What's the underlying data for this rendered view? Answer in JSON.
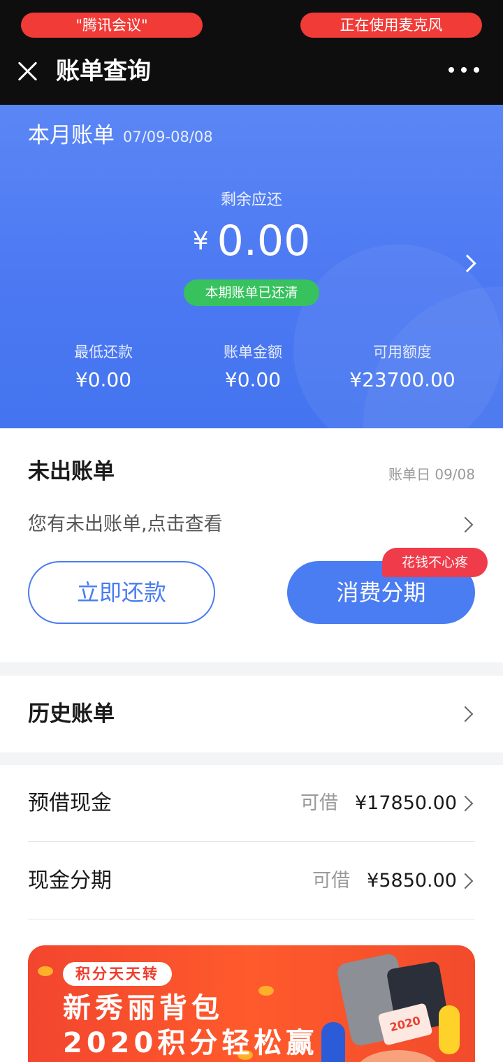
{
  "status": {
    "left_pill": "\"腾讯会议\"",
    "right_pill": "正在使用麦克风"
  },
  "nav": {
    "title": "账单查询"
  },
  "bill": {
    "title": "本月账单",
    "period": "07/09-08/08",
    "remain_label": "剩余应还",
    "currency": "¥",
    "remain_amount": "0.00",
    "status_badge": "本期账单已还清",
    "stats": [
      {
        "label": "最低还款",
        "value": "¥0.00"
      },
      {
        "label": "账单金额",
        "value": "¥0.00"
      },
      {
        "label": "可用额度",
        "value": "¥23700.00"
      }
    ]
  },
  "unbilled": {
    "title": "未出账单",
    "bill_day": "账单日 09/08",
    "hint": "您有未出账单,点击查看",
    "repay_button": "立即还款",
    "installment_button": "消费分期",
    "promo_tag": "花钱不心疼"
  },
  "history": {
    "title": "历史账单"
  },
  "loans": [
    {
      "name": "预借现金",
      "prefix": "可借",
      "amount": "¥17850.00"
    },
    {
      "name": "现金分期",
      "prefix": "可借",
      "amount": "¥5850.00"
    }
  ],
  "banner": {
    "tag": "积分天天转",
    "line1": "新秀丽背包",
    "line2": "2020积分轻松赢",
    "ticket_text": "2020"
  },
  "colors": {
    "primary_blue": "#4a7cf2",
    "success_green": "#37c25e",
    "alert_red": "#f03b37",
    "banner_orange": "#ff5a2c"
  }
}
